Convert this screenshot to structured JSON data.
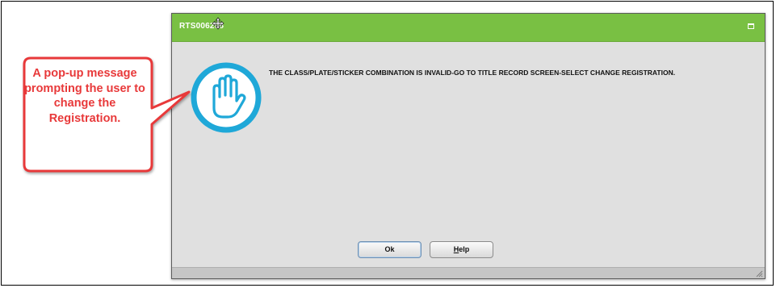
{
  "dialog": {
    "title": "RTS006208",
    "message": "THE CLASS/PLATE/STICKER COMBINATION IS INVALID-GO TO TITLE RECORD SCREEN-SELECT CHANGE REGISTRATION.",
    "ok_label": "Ok",
    "help_label": "Help",
    "icon": "stop-hand-icon",
    "title_color": "#79c043"
  },
  "annotation": {
    "callout_text": "A pop-up message prompting the user to change the Registration.",
    "callout_color": "#e8393a"
  }
}
